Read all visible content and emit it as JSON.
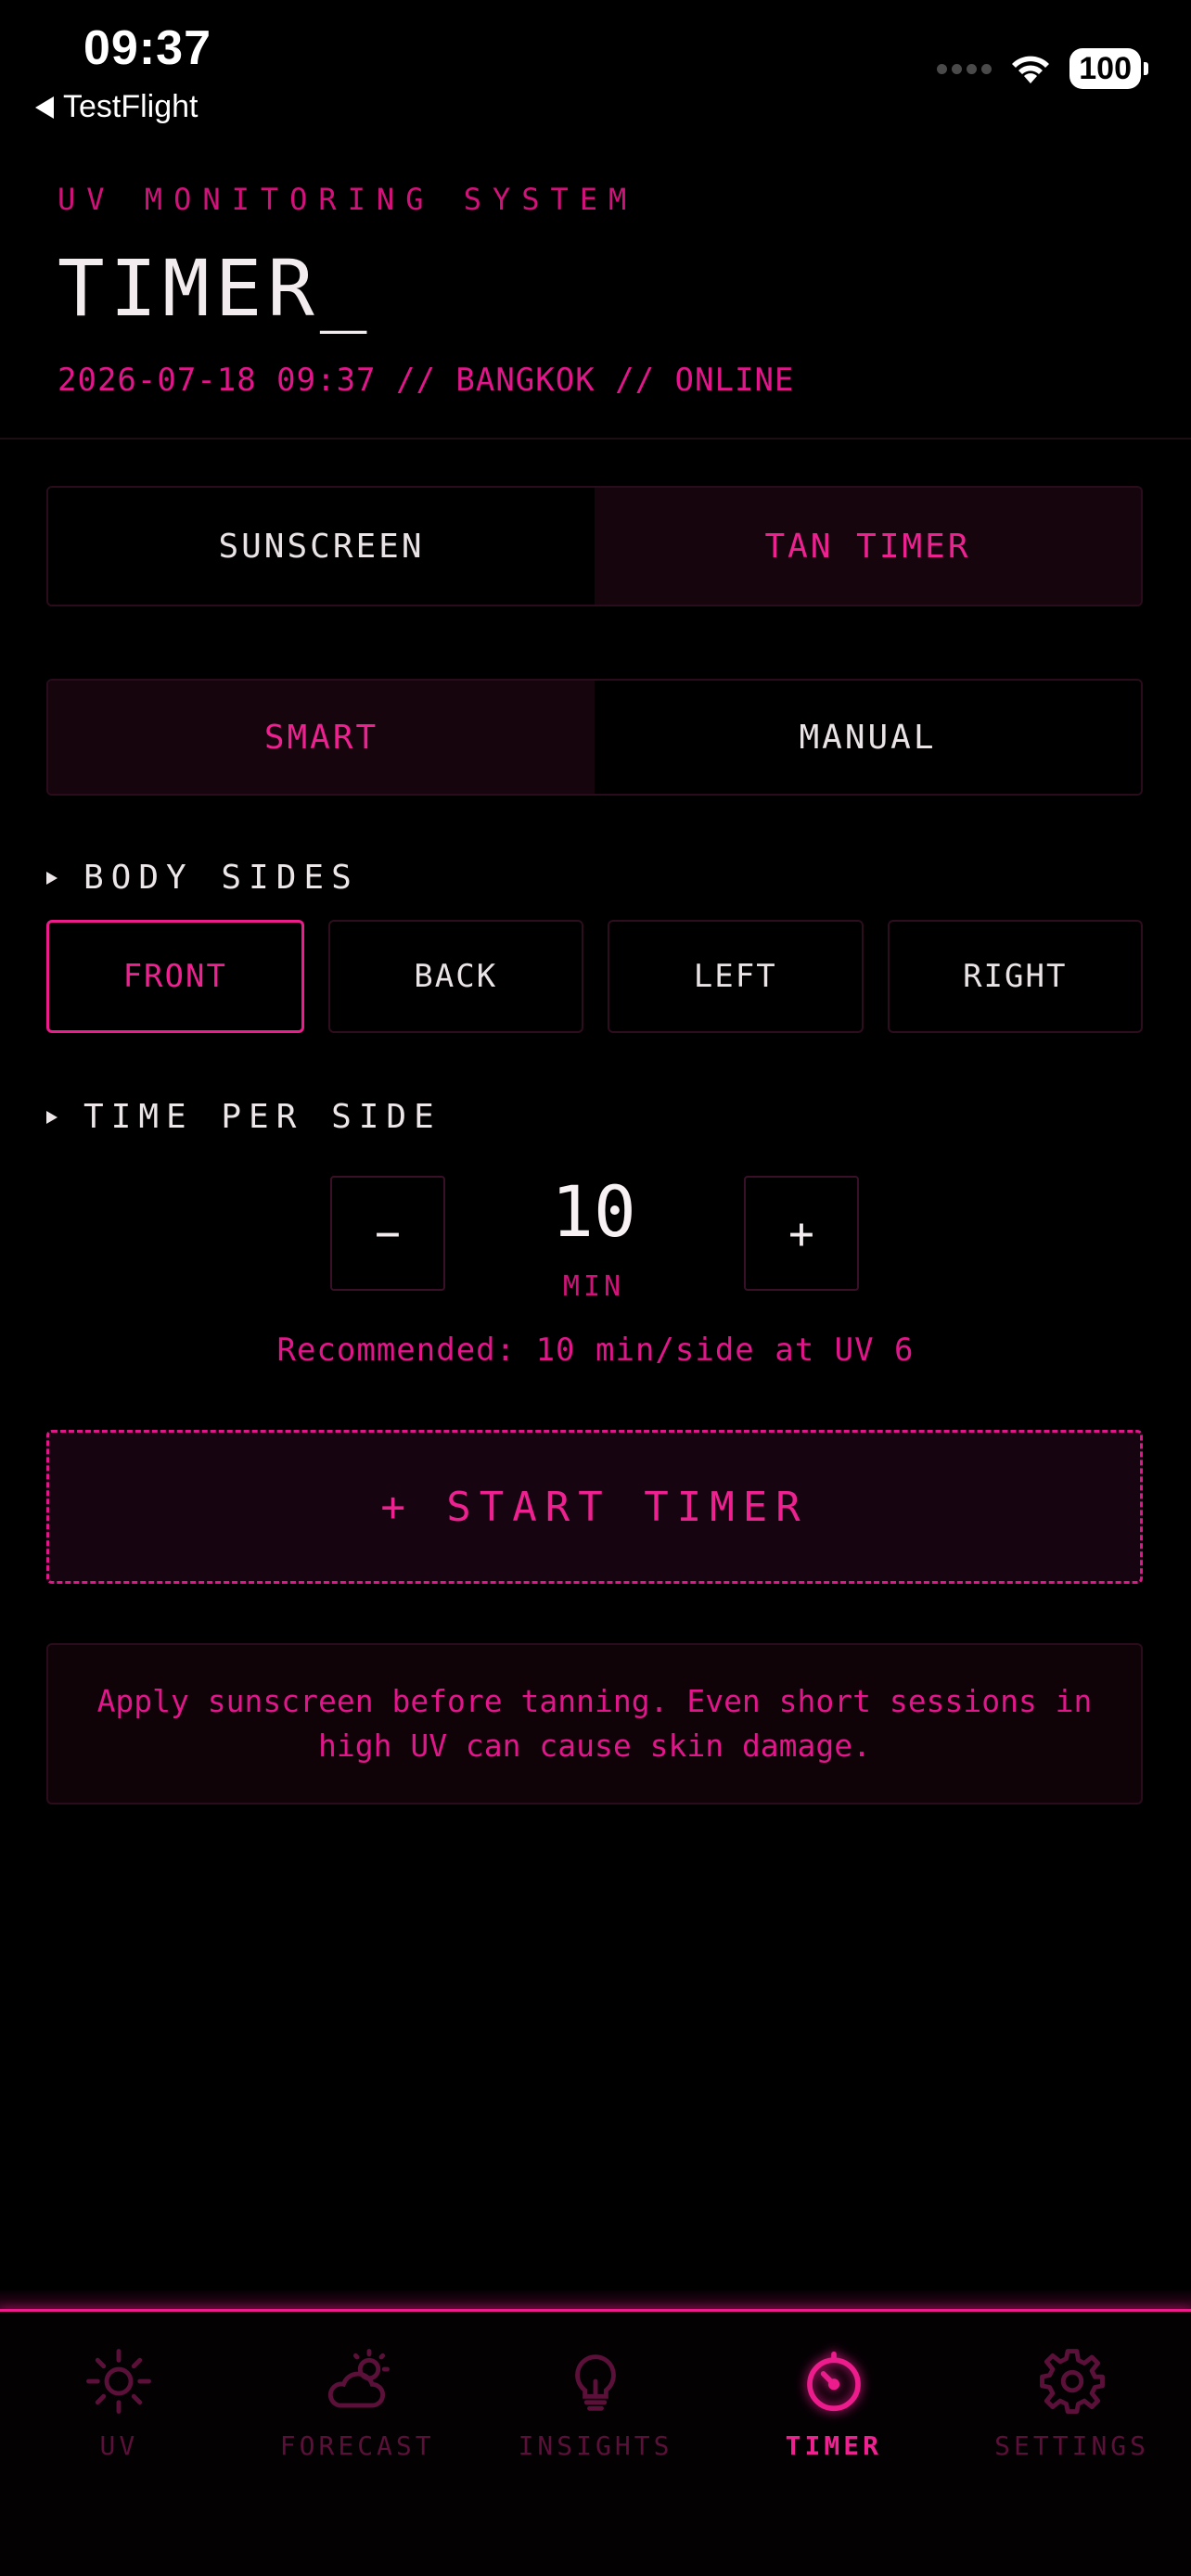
{
  "status_bar": {
    "time": "09:37",
    "back_label": "TestFlight",
    "battery": "100"
  },
  "header": {
    "system_label": "UV MONITORING SYSTEM",
    "title": "TIMER_",
    "meta": "2026-07-18 09:37 // BANGKOK // ONLINE"
  },
  "mode_tabs": {
    "items": [
      {
        "label": "SUNSCREEN",
        "active": false
      },
      {
        "label": "TAN TIMER",
        "active": true
      }
    ]
  },
  "timer_mode": {
    "items": [
      {
        "label": "SMART",
        "active": true
      },
      {
        "label": "MANUAL",
        "active": false
      }
    ]
  },
  "body_sides": {
    "heading": "BODY SIDES",
    "items": [
      {
        "label": "FRONT",
        "active": true
      },
      {
        "label": "BACK",
        "active": false
      },
      {
        "label": "LEFT",
        "active": false
      },
      {
        "label": "RIGHT",
        "active": false
      }
    ]
  },
  "time_per_side": {
    "heading": "TIME PER SIDE",
    "decrement_label": "−",
    "increment_label": "+",
    "value": "10",
    "unit": "MIN",
    "recommendation": "Recommended: 10 min/side at UV 6"
  },
  "start_button": {
    "label": "+ START TIMER"
  },
  "notice": {
    "text": "Apply sunscreen before tanning. Even short sessions in high UV can cause skin damage."
  },
  "tab_bar": {
    "items": [
      {
        "label": "UV",
        "icon": "sun-icon",
        "active": false
      },
      {
        "label": "FORECAST",
        "icon": "cloud-sun-icon",
        "active": false
      },
      {
        "label": "INSIGHTS",
        "icon": "lightbulb-icon",
        "active": false
      },
      {
        "label": "TIMER",
        "icon": "timer-icon",
        "active": true
      },
      {
        "label": "SETTINGS",
        "icon": "gear-icon",
        "active": false
      }
    ]
  },
  "colors": {
    "accent": "#ec1c8c",
    "background": "#000000",
    "inactive_tab": "#5a1038"
  }
}
